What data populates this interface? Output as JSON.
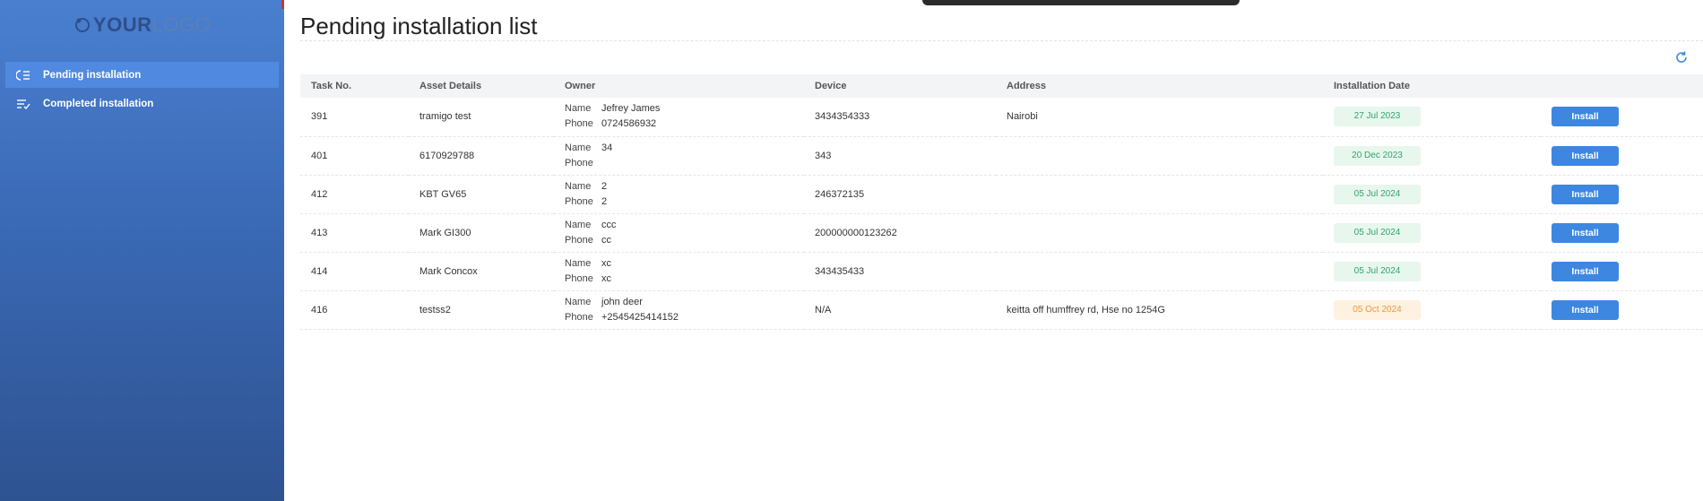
{
  "logo": {
    "strong": "YOUR",
    "light": "LOGO"
  },
  "sidebar": {
    "items": [
      {
        "label": "Pending installation",
        "active": true,
        "icon": "list-pending-icon"
      },
      {
        "label": "Completed installation",
        "active": false,
        "icon": "list-check-icon"
      }
    ]
  },
  "page": {
    "title": "Pending installation list"
  },
  "table": {
    "headers": [
      "Task No.",
      "Asset Details",
      "Owner",
      "Device",
      "Address",
      "Installation Date",
      ""
    ],
    "owner_keys": {
      "name": "Name",
      "phone": "Phone"
    },
    "rows": [
      {
        "task": "391",
        "asset": "tramigo test",
        "owner_name": "Jefrey James",
        "owner_phone": "0724586932",
        "device": "3434354333",
        "address": "Nairobi",
        "date": "27 Jul 2023",
        "date_status": "green",
        "action": "Install"
      },
      {
        "task": "401",
        "asset": "6170929788",
        "owner_name": "34",
        "owner_phone": "",
        "device": "343",
        "address": "",
        "date": "20 Dec 2023",
        "date_status": "green",
        "action": "Install"
      },
      {
        "task": "412",
        "asset": "KBT GV65",
        "owner_name": "2",
        "owner_phone": "2",
        "device": "246372135",
        "address": "",
        "date": "05 Jul 2024",
        "date_status": "green",
        "action": "Install"
      },
      {
        "task": "413",
        "asset": "Mark GI300",
        "owner_name": "ccc",
        "owner_phone": "cc",
        "device": "200000000123262",
        "address": "",
        "date": "05 Jul 2024",
        "date_status": "green",
        "action": "Install"
      },
      {
        "task": "414",
        "asset": "Mark Concox",
        "owner_name": "xc",
        "owner_phone": "xc",
        "device": "343435433",
        "address": "",
        "date": "05 Jul 2024",
        "date_status": "green",
        "action": "Install"
      },
      {
        "task": "416",
        "asset": "testss2",
        "owner_name": "john deer",
        "owner_phone": "+2545425414152",
        "device": "N/A",
        "address": "keitta off humffrey rd, Hse no 1254G",
        "date": "05 Oct 2024",
        "date_status": "orange",
        "action": "Install"
      }
    ]
  },
  "colors": {
    "sidebar_top": "#4a7fd0",
    "sidebar_bottom": "#2e5391",
    "active_item": "#4f8ae0",
    "button": "#3d87e0",
    "badge_green_text": "#34a36a",
    "badge_orange_text": "#e89a3c"
  }
}
